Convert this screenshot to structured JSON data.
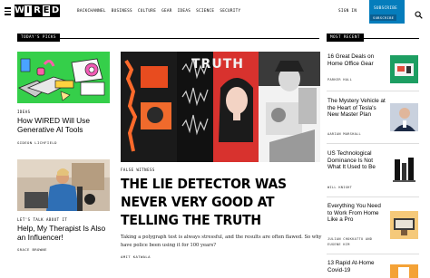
{
  "nav": {
    "links": [
      "BACKCHANNEL",
      "BUSINESS",
      "CULTURE",
      "GEAR",
      "IDEAS",
      "SCIENCE",
      "SECURITY"
    ],
    "sign_in": "SIGN IN",
    "subscribe": "SUBSCRIBE",
    "subscribe_sub": "SUBSCRIBE",
    "brand_color": "#057dbc"
  },
  "logo": {
    "letters": [
      "W",
      "I",
      "R",
      "E",
      "D"
    ]
  },
  "todays_picks": {
    "label": "TODAY'S PICKS",
    "cards": [
      {
        "kicker": "IDEAS",
        "title": "How WIRED Will Use Generative AI Tools",
        "byline": "GIDEON LICHFIELD"
      },
      {
        "kicker": "LET'S TALK ABOUT IT",
        "title": "Help, My Therapist Is Also an Influencer!",
        "byline": "GRACE BROWNE"
      }
    ]
  },
  "hero": {
    "image_text": "TRUTH",
    "kicker": "FALSE WITNESS",
    "title": "THE LIE DETECTOR WAS NEVER VERY GOOD AT TELLING THE TRUTH",
    "dek": "Taking a polygraph test is always stressful, and the results are often flawed. So why have police been using it for 100 years?",
    "byline": "AMIT KATWALA"
  },
  "most_recent": {
    "label": "MOST RECENT",
    "items": [
      {
        "title": "16 Great Deals on Home Office Gear",
        "byline": "PARKER HALL"
      },
      {
        "title": "The Mystery Vehicle at the Heart of Tesla's New Master Plan",
        "byline": "AARIAN MARSHALL"
      },
      {
        "title": "US Technological Dominance Is Not What It Used to Be",
        "byline": "WILL KNIGHT"
      },
      {
        "title": "Everything You Need to Work From Home Like a Pro",
        "byline": "JULIAN CHOKKATTU AND EUGENE KIM"
      },
      {
        "title": "13 Rapid At-Home Covid-19",
        "byline": ""
      }
    ]
  }
}
